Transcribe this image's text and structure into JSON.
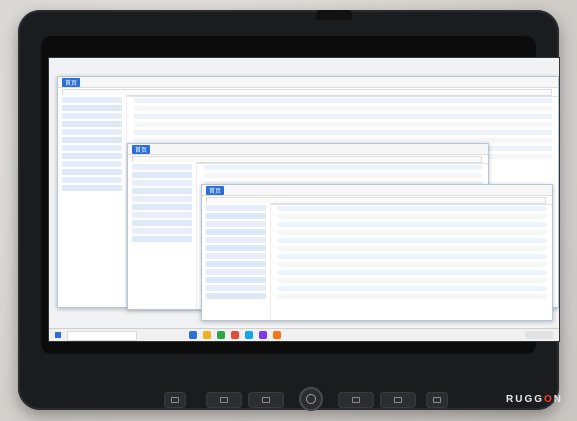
{
  "brand": {
    "logo_text_left": "RUGG",
    "logo_text_mark": "O",
    "logo_text_right": "N"
  },
  "screen": {
    "window_1_tab": "首页",
    "window_2_tab": "首页",
    "window_3_tab": "首页"
  },
  "hardware": {
    "buttons": [
      {
        "name": "menu-button"
      },
      {
        "name": "left-button"
      },
      {
        "name": "right-button"
      },
      {
        "name": "vol-down-button"
      },
      {
        "name": "vol-up-button"
      },
      {
        "name": "window-button"
      }
    ]
  }
}
